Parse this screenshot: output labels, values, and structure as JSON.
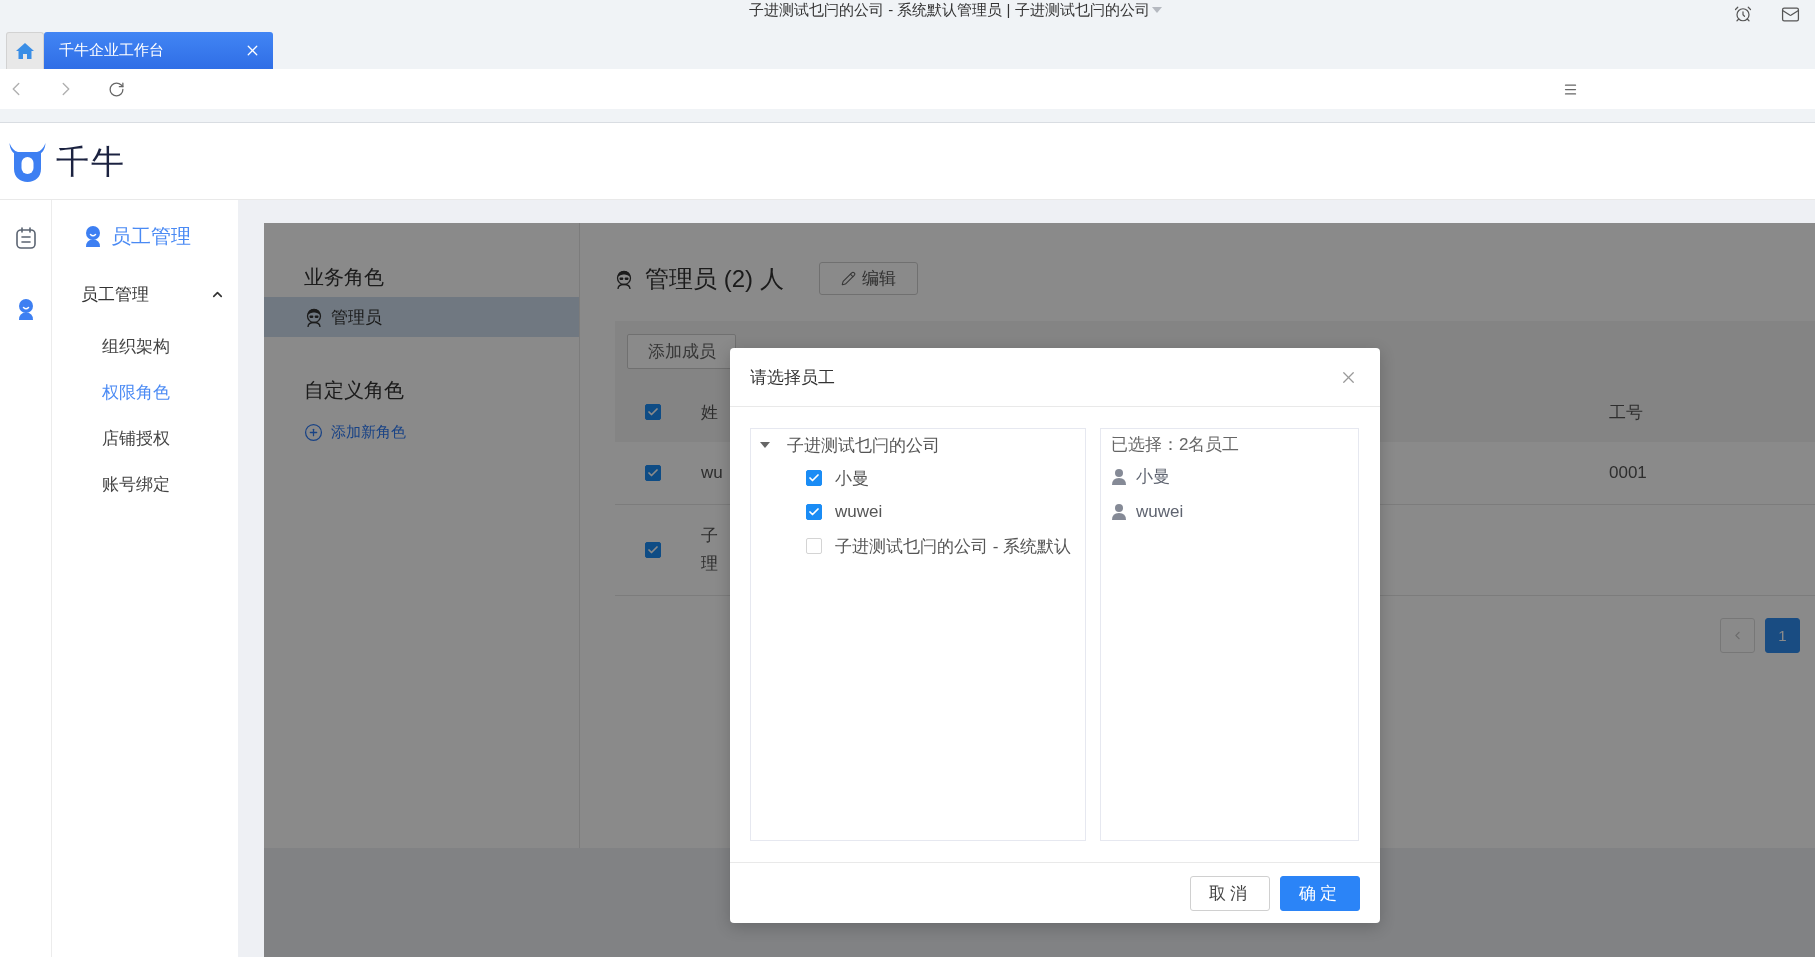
{
  "window": {
    "title": "子进测试乜闩的公司 - 系统默认管理员 | 子进测试乜闩的公司"
  },
  "browser_tabs": [
    {
      "label": "千牛企业工作台",
      "selected": true
    }
  ],
  "app_header": {
    "logo_text": "千牛"
  },
  "rail": [
    {
      "kind": "notepad",
      "selected": false
    },
    {
      "kind": "person",
      "selected": true
    }
  ],
  "sidebar": {
    "title": "员工管理",
    "group": {
      "label": "员工管理",
      "expanded": true,
      "items": [
        {
          "label": "组织架构",
          "selected": false
        },
        {
          "label": "权限角色",
          "selected": true
        },
        {
          "label": "店铺授权",
          "selected": false
        },
        {
          "label": "账号绑定",
          "selected": false
        }
      ]
    }
  },
  "roles": {
    "business_heading": "业务角色",
    "business_roles": [
      {
        "label": "管理员",
        "selected": true
      }
    ],
    "custom_heading": "自定义角色",
    "add_role_link": "添加新角色"
  },
  "members": {
    "title": "管理员 (2) 人",
    "edit_button": "编辑",
    "toolbar_buttons": [
      "添加成员"
    ],
    "table": {
      "select_all_checked": true,
      "columns": [
        "姓",
        "工号"
      ],
      "rows": [
        {
          "checked": true,
          "name_lines": [
            "wu"
          ],
          "employee_no": "0001"
        },
        {
          "checked": true,
          "name_lines": [
            "子",
            "理"
          ]
        }
      ]
    },
    "pagination": {
      "pages": [
        {
          "label": "1",
          "selected": true
        }
      ]
    }
  },
  "modal": {
    "title": "请选择员工",
    "tree": {
      "label": "子进测试乜闩的公司",
      "expanded": true,
      "children": [
        {
          "label": "小曼",
          "checked": true
        },
        {
          "label": "wuwei",
          "checked": true
        },
        {
          "label": "子进测试乜闩的公司 - 系统默认",
          "checked": false
        }
      ]
    },
    "selected_heading": "已选择：2名员工",
    "selected_people": [
      "小曼",
      "wuwei"
    ],
    "buttons": [
      {
        "label": "取消",
        "kind": "default"
      },
      {
        "label": "确定",
        "kind": "primary"
      }
    ]
  }
}
